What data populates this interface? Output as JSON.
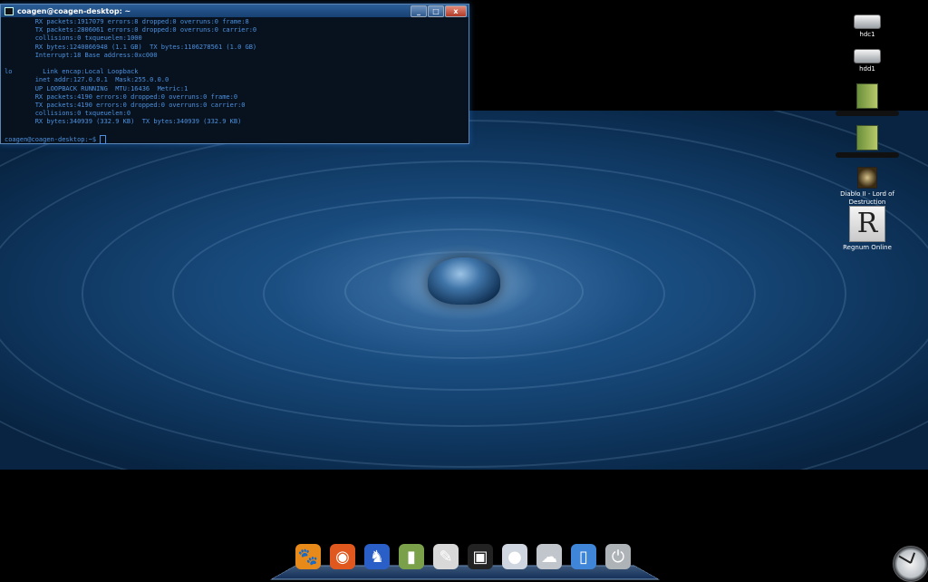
{
  "terminal": {
    "title": "coagen@coagen-desktop: ~",
    "buttons": {
      "minimize": "_",
      "maximize": "□",
      "close": "x"
    },
    "lines": [
      "        RX packets:1917079 errors:8 dropped:0 overruns:0 frame:8",
      "        TX packets:2806061 errors:0 dropped:0 overruns:0 carrier:0",
      "        collisions:0 txqueuelen:1000",
      "        RX bytes:1240866948 (1.1 GB)  TX bytes:1106278561 (1.0 GB)",
      "        Interrupt:18 Base address:0xc000",
      "",
      "lo        Link encap:Local Loopback",
      "        inet addr:127.0.0.1  Mask:255.0.0.0",
      "        UP LOOPBACK RUNNING  MTU:16436  Metric:1",
      "        RX packets:4190 errors:0 dropped:0 overruns:0 frame:0",
      "        TX packets:4190 errors:0 dropped:0 overruns:0 carrier:0",
      "        collisions:0 txqueuelen:0",
      "        RX bytes:340939 (332.9 KB)  TX bytes:340939 (332.9 KB)",
      ""
    ],
    "prompt": "coagen@coagen-desktop:~$ "
  },
  "desktop_icons": {
    "hdc1": "hdc1",
    "hdd1": "hdd1",
    "diablo": "Diablo II - Lord of Destruction",
    "regnum": "Regnum Online",
    "regnum_letter": "R"
  },
  "dock": [
    {
      "name": "gimp-icon",
      "glyph": "🐾",
      "color": "#e88a1a"
    },
    {
      "name": "firefox-icon",
      "glyph": "◉",
      "color": "#e0581d"
    },
    {
      "name": "kde-games-icon",
      "glyph": "♞",
      "color": "#2a5fc7"
    },
    {
      "name": "file-manager-icon",
      "glyph": "▮",
      "color": "#7aa04a"
    },
    {
      "name": "text-editor-icon",
      "glyph": "✎",
      "color": "#d8d8d8"
    },
    {
      "name": "terminal-icon",
      "glyph": "▣",
      "color": "#222222"
    },
    {
      "name": "pidgin-icon",
      "glyph": "●",
      "color": "#cfd6df"
    },
    {
      "name": "weather-icon",
      "glyph": "☁",
      "color": "#c0c6cc"
    },
    {
      "name": "trash-icon",
      "glyph": "▯",
      "color": "#3f86d8"
    },
    {
      "name": "power-icon",
      "glyph": "⏻",
      "color": "#aeb3b8"
    }
  ]
}
